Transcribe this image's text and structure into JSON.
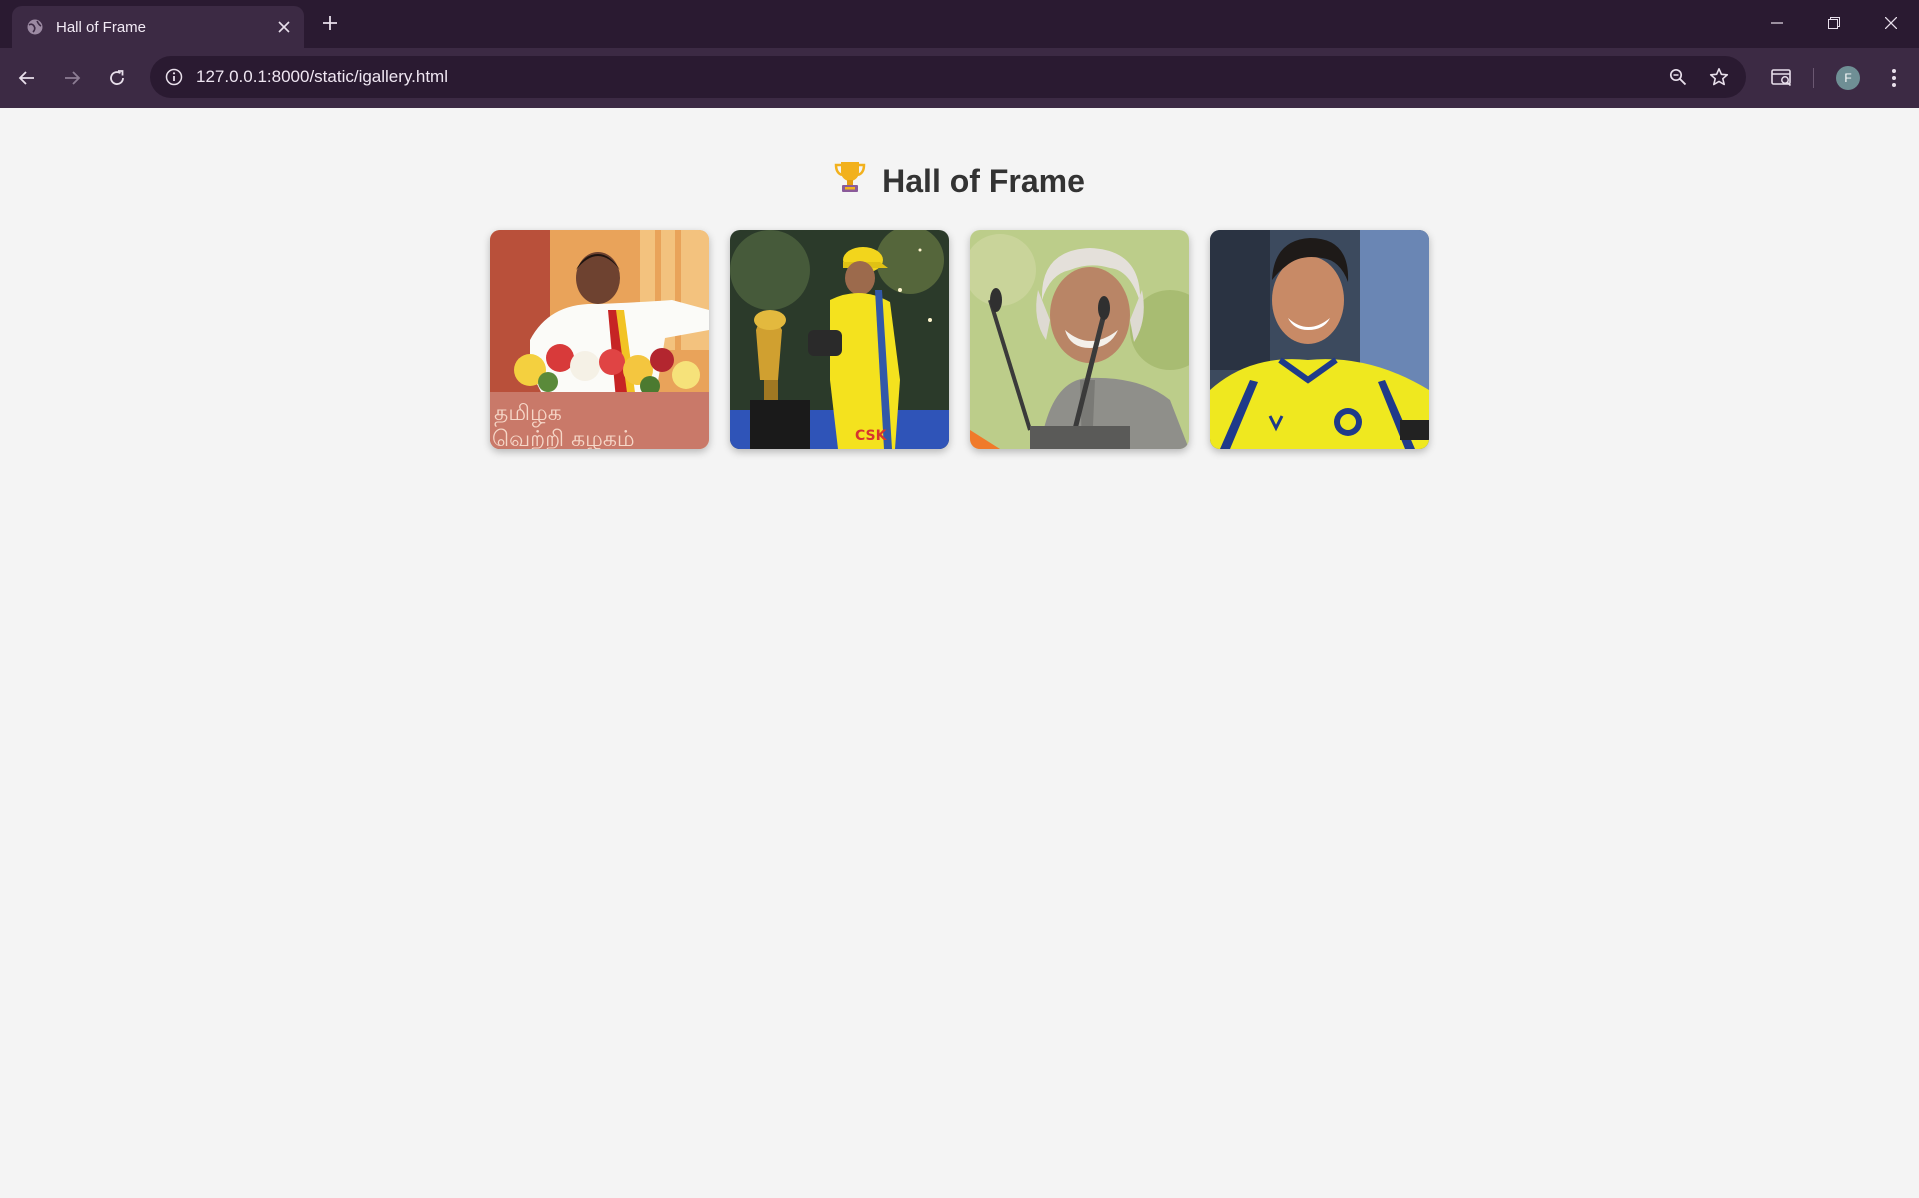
{
  "browser": {
    "tab_title": "Hall of Frame",
    "url": "127.0.0.1:8000/static/igallery.html",
    "profile_initial": "F"
  },
  "page": {
    "heading": "Hall of Frame",
    "heading_icon": "trophy-icon",
    "gallery": [
      {
        "name": "gallery-image-1",
        "subject": "speaker-at-podium-with-flowers"
      },
      {
        "name": "gallery-image-2",
        "subject": "cricketer-with-trophy"
      },
      {
        "name": "gallery-image-3",
        "subject": "elder-speaker-at-microphone"
      },
      {
        "name": "gallery-image-4",
        "subject": "footballer-yellow-jersey"
      }
    ]
  },
  "colors": {
    "chrome_dark": "#2a1a31",
    "chrome": "#3c2a44",
    "page_bg": "#f4f4f4",
    "heading": "#333333"
  }
}
